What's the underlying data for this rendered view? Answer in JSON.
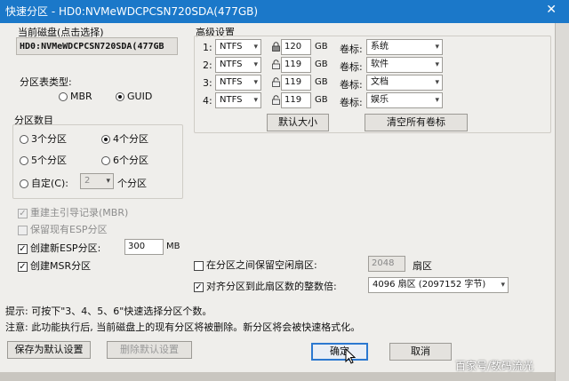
{
  "window": {
    "title": "快速分区 - HD0:NVMeWDCPCSN720SDA(477GB)",
    "close_glyph": "✕"
  },
  "disk": {
    "label": "当前磁盘(点击选择)",
    "value": "HD0:NVMeWDCPCSN720SDA(477GB"
  },
  "partition_table": {
    "label": "分区表类型:",
    "mbr": "MBR",
    "guid": "GUID",
    "selected": "GUID"
  },
  "partition_count": {
    "label": "分区数目",
    "opt3": "3个分区",
    "opt4": "4个分区",
    "opt5": "5个分区",
    "opt6": "6个分区",
    "custom": "自定(C):",
    "custom_value": "2",
    "custom_suffix": "个分区",
    "selected": "4个分区"
  },
  "options": {
    "rebuild_mbr": "重建主引导记录(MBR)",
    "keep_esp": "保留现有ESP分区",
    "create_esp": "创建新ESP分区:",
    "esp_size": "300",
    "esp_unit": "MB",
    "create_msr": "创建MSR分区"
  },
  "advanced": {
    "label": "高级设置",
    "size_unit": "GB",
    "volume_label": "卷标:",
    "rows": [
      {
        "index": "1:",
        "fs": "NTFS",
        "size": "120",
        "name": "系统"
      },
      {
        "index": "2:",
        "fs": "NTFS",
        "size": "119",
        "name": "软件"
      },
      {
        "index": "3:",
        "fs": "NTFS",
        "size": "119",
        "name": "文档"
      },
      {
        "index": "4:",
        "fs": "NTFS",
        "size": "119",
        "name": "娱乐"
      }
    ],
    "default_size_button": "默认大小",
    "clear_labels_button": "清空所有卷标"
  },
  "gap": {
    "label": "在分区之间保留空闲扇区:",
    "value": "2048",
    "unit": "扇区"
  },
  "align": {
    "label": "对齐分区到此扇区数的整数倍:",
    "value": "4096 扇区 (2097152 字节)"
  },
  "hints": {
    "tip": "提示: 可按下\"3、4、5、6\"快速选择分区个数。",
    "note": "注意: 此功能执行后, 当前磁盘上的现有分区将被删除。新分区将会被快速格式化。"
  },
  "buttons": {
    "save_default": "保存为默认设置",
    "delete_default": "删除默认设置",
    "ok": "确定",
    "cancel": "取消"
  },
  "watermark": "百家号/数码流光"
}
